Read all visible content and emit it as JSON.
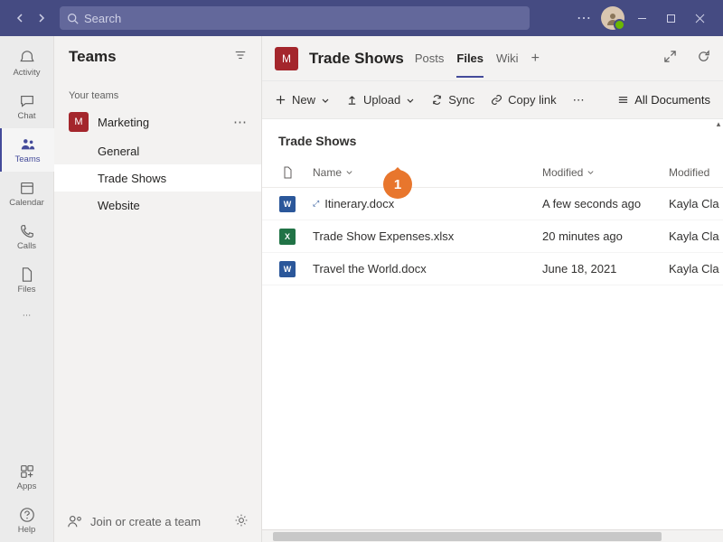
{
  "titlebar": {
    "search_placeholder": "Search"
  },
  "rail": {
    "items": [
      {
        "key": "activity",
        "label": "Activity"
      },
      {
        "key": "chat",
        "label": "Chat"
      },
      {
        "key": "teams",
        "label": "Teams"
      },
      {
        "key": "calendar",
        "label": "Calendar"
      },
      {
        "key": "calls",
        "label": "Calls"
      },
      {
        "key": "files",
        "label": "Files"
      }
    ],
    "apps": "Apps",
    "help": "Help"
  },
  "panel": {
    "title": "Teams",
    "section": "Your teams",
    "team": {
      "initial": "M",
      "name": "Marketing"
    },
    "channels": [
      "General",
      "Trade Shows",
      "Website"
    ],
    "join": "Join or create a team"
  },
  "channel_header": {
    "initial": "M",
    "title": "Trade Shows",
    "tabs": [
      "Posts",
      "Files",
      "Wiki"
    ]
  },
  "cmdbar": {
    "new": "New",
    "upload": "Upload",
    "sync": "Sync",
    "copylink": "Copy link",
    "alldocs": "All Documents"
  },
  "files": {
    "crumb": "Trade Shows",
    "columns": {
      "name": "Name",
      "modified": "Modified",
      "modified_by": "Modified"
    },
    "rows": [
      {
        "type": "word",
        "name": "Itinerary.docx",
        "modified": "A few seconds ago",
        "by": "Kayla Cla"
      },
      {
        "type": "xls",
        "name": "Trade Show Expenses.xlsx",
        "modified": "20 minutes ago",
        "by": "Kayla Cla"
      },
      {
        "type": "word",
        "name": "Travel the World.docx",
        "modified": "June 18, 2021",
        "by": "Kayla Cla"
      }
    ]
  },
  "callout": {
    "num": "1"
  }
}
